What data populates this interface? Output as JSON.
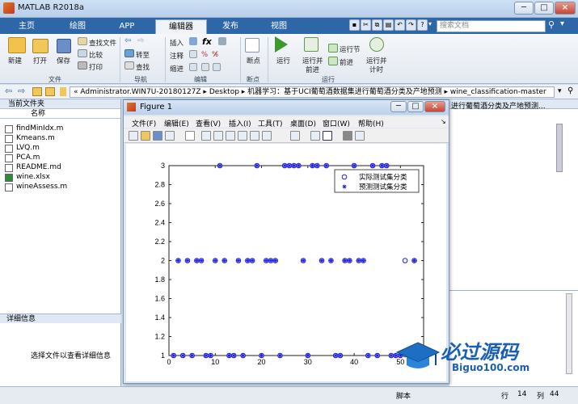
{
  "window": {
    "title": "MATLAB R2018a"
  },
  "tabs": [
    {
      "label": "主页"
    },
    {
      "label": "绘图"
    },
    {
      "label": "APP"
    },
    {
      "label": "编辑器"
    },
    {
      "label": "发布"
    },
    {
      "label": "视图"
    }
  ],
  "search": {
    "placeholder": "搜索文档"
  },
  "ribbon": {
    "new": "新建",
    "open": "打开",
    "save": "保存",
    "find_files": "查找文件",
    "compare": "比较",
    "print": "打印",
    "goto": "转至",
    "find": "查找",
    "insert": "插入",
    "comment": "注释",
    "indent": "缩进",
    "breakpoint": "断点",
    "run": "运行",
    "run_advance_1": "运行并",
    "run_advance_2": "前进",
    "run_section": "运行节",
    "advance": "前进",
    "run_time_1": "运行并",
    "run_time_2": "计时",
    "group_file": "文件",
    "group_nav": "导航",
    "group_edit": "编辑",
    "group_bp": "断点",
    "group_run": "运行",
    "fx": "fx"
  },
  "address": {
    "path": "« Administrator.WIN7U-20180127Z  ▸  Desktop  ▸  机器学习：基于UCI葡萄酒数据集进行葡萄酒分类及产地预测  ▸  wine_classification-master"
  },
  "left_panel": {
    "title": "当前文件夹",
    "col_name": "名称",
    "files": [
      {
        "name": "findMinIdx.m"
      },
      {
        "name": "Kmeans.m"
      },
      {
        "name": "LVQ.m"
      },
      {
        "name": "PCA.m"
      },
      {
        "name": "README.md"
      },
      {
        "name": "wine.xlsx"
      },
      {
        "name": "wineAssess.m"
      }
    ],
    "detail_title": "详细信息",
    "detail_text": "选择文件以查看详细信息"
  },
  "right_panel": {
    "crumb": "进行葡萄酒分类及产地预测..."
  },
  "status": {
    "script": "脚本",
    "row_label": "行",
    "row": "14",
    "col_label": "列",
    "col": "44"
  },
  "figure": {
    "title": "Figure 1",
    "menu": [
      "文件(F)",
      "编辑(E)",
      "查看(V)",
      "插入(I)",
      "工具(T)",
      "桌面(D)",
      "窗口(W)",
      "帮助(H)"
    ]
  },
  "watermark": {
    "cn": "必过源码",
    "en": "Biguo100.com"
  },
  "colors": {
    "series": "#1f1fe0",
    "tabbar": "#2e67a8"
  },
  "chart_data": {
    "type": "scatter",
    "title": "",
    "xlabel": "",
    "ylabel": "",
    "xlim": [
      0,
      55
    ],
    "ylim": [
      1,
      3
    ],
    "xticks": [
      0,
      10,
      20,
      30,
      40,
      50
    ],
    "yticks": [
      1,
      1.2,
      1.4,
      1.6,
      1.8,
      2,
      2.2,
      2.4,
      2.6,
      2.8,
      3
    ],
    "legend_position": "top-right",
    "series": [
      {
        "name": "实际测试集分类",
        "marker": "circle",
        "x": [
          1,
          2,
          3,
          4,
          5,
          6,
          7,
          8,
          9,
          10,
          11,
          12,
          13,
          14,
          15,
          16,
          17,
          18,
          19,
          20,
          21,
          22,
          23,
          24,
          25,
          26,
          27,
          28,
          29,
          30,
          31,
          32,
          33,
          34,
          35,
          36,
          37,
          38,
          39,
          40,
          41,
          42,
          43,
          44,
          45,
          46,
          47,
          48,
          49,
          50,
          51,
          52,
          53
        ],
        "y": [
          1,
          2,
          1,
          2,
          1,
          2,
          2,
          1,
          1,
          2,
          3,
          2,
          1,
          1,
          2,
          1,
          2,
          2,
          3,
          1,
          2,
          2,
          2,
          1,
          3,
          3,
          3,
          3,
          2,
          1,
          3,
          3,
          2,
          3,
          2,
          1,
          1,
          2,
          2,
          3,
          2,
          2,
          1,
          3,
          1,
          3,
          3,
          1,
          1,
          1,
          2,
          1,
          2
        ]
      },
      {
        "name": "预测测试集分类",
        "marker": "asterisk",
        "x": [
          1,
          2,
          3,
          4,
          5,
          6,
          7,
          8,
          9,
          10,
          11,
          12,
          13,
          14,
          15,
          16,
          17,
          18,
          19,
          20,
          21,
          22,
          23,
          24,
          25,
          26,
          27,
          28,
          29,
          30,
          31,
          32,
          33,
          34,
          35,
          36,
          37,
          38,
          39,
          40,
          41,
          42,
          43,
          44,
          45,
          46,
          47,
          48,
          49,
          50,
          51,
          52,
          53
        ],
        "y": [
          1,
          2,
          1,
          2,
          1,
          2,
          2,
          1,
          1,
          2,
          3,
          2,
          1,
          1,
          2,
          1,
          2,
          2,
          3,
          1,
          2,
          2,
          2,
          1,
          3,
          3,
          3,
          3,
          2,
          1,
          3,
          3,
          2,
          3,
          2,
          1,
          1,
          2,
          2,
          3,
          2,
          2,
          1,
          3,
          1,
          3,
          3,
          1,
          1,
          1,
          1,
          1,
          2
        ]
      }
    ]
  }
}
